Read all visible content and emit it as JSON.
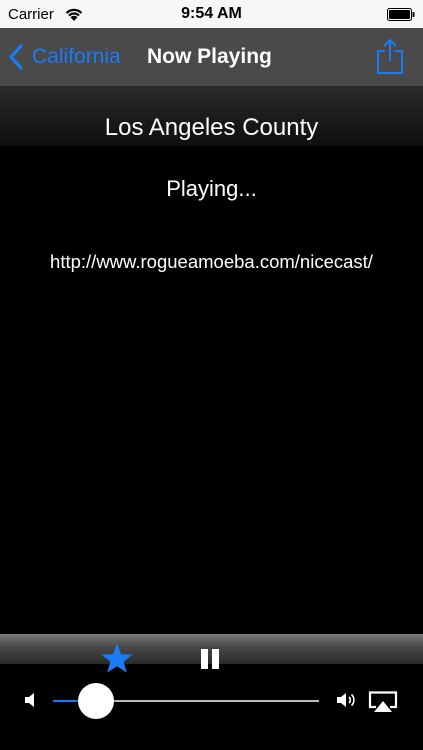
{
  "status_bar": {
    "carrier": "Carrier",
    "time": "9:54 AM"
  },
  "nav": {
    "back_label": "California",
    "title": "Now Playing"
  },
  "station": {
    "name": "Los Angeles County"
  },
  "player": {
    "status": "Playing...",
    "url": "http://www.rogueamoeba.com/nicecast/",
    "volume": 0.16,
    "favorite": true
  },
  "colors": {
    "accent": "#1a7cf5",
    "background": "#000000",
    "nav_background": "#4a4a4a"
  },
  "icons": {
    "back": "chevron-left-icon",
    "share": "share-icon",
    "favorite": "star-icon",
    "pause": "pause-icon",
    "volume_low": "volume-low-icon",
    "volume_high": "volume-high-icon",
    "airplay": "airplay-icon",
    "wifi": "wifi-icon",
    "battery": "battery-icon"
  }
}
